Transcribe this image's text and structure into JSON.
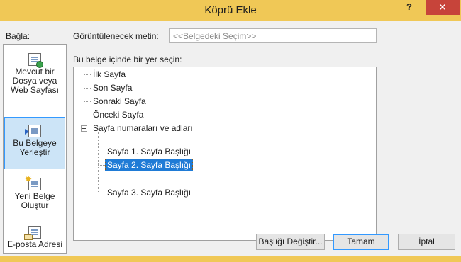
{
  "window": {
    "title": "Köprü Ekle",
    "help_glyph": "?",
    "close_glyph": "✕",
    "accent_color": "#f0c856"
  },
  "link_to": {
    "label": "Bağla:",
    "items": [
      {
        "label_lines": [
          "Mevcut bir",
          "Dosya veya",
          "Web Sayfası"
        ],
        "icon": "existing-file-icon",
        "selected": false
      },
      {
        "label_lines": [
          "Bu Belgeye",
          "Yerleştir"
        ],
        "icon": "place-in-document-icon",
        "selected": true
      },
      {
        "label_lines": [
          "Yeni Belge",
          "Oluştur"
        ],
        "icon": "new-document-icon",
        "selected": false
      },
      {
        "label_lines": [
          "E-posta Adresi"
        ],
        "icon": "email-address-icon",
        "selected": false
      }
    ]
  },
  "display_text": {
    "label": "Görüntülenecek metin:",
    "value": "<<Belgedeki Seçim>>"
  },
  "place": {
    "label": "Bu belge içinde bir yer seçin:",
    "tree": [
      {
        "label": "İlk Sayfa",
        "level": 0
      },
      {
        "label": "Son Sayfa",
        "level": 0
      },
      {
        "label": "Sonraki Sayfa",
        "level": 0
      },
      {
        "label": "Önceki Sayfa",
        "level": 0
      },
      {
        "label": "Sayfa numaraları ve adları",
        "level": 0,
        "expanded": true
      },
      {
        "label": "Sayfa 1. Sayfa Başlığı",
        "level": 1
      },
      {
        "label": "Sayfa 2. Sayfa Başlığı",
        "level": 1,
        "selected": true
      },
      {
        "label": "Sayfa 3. Sayfa Başlığı",
        "level": 1
      }
    ]
  },
  "buttons": {
    "change_title": "Başlığı Değiştir...",
    "ok": "Tamam",
    "cancel": "İptal"
  }
}
